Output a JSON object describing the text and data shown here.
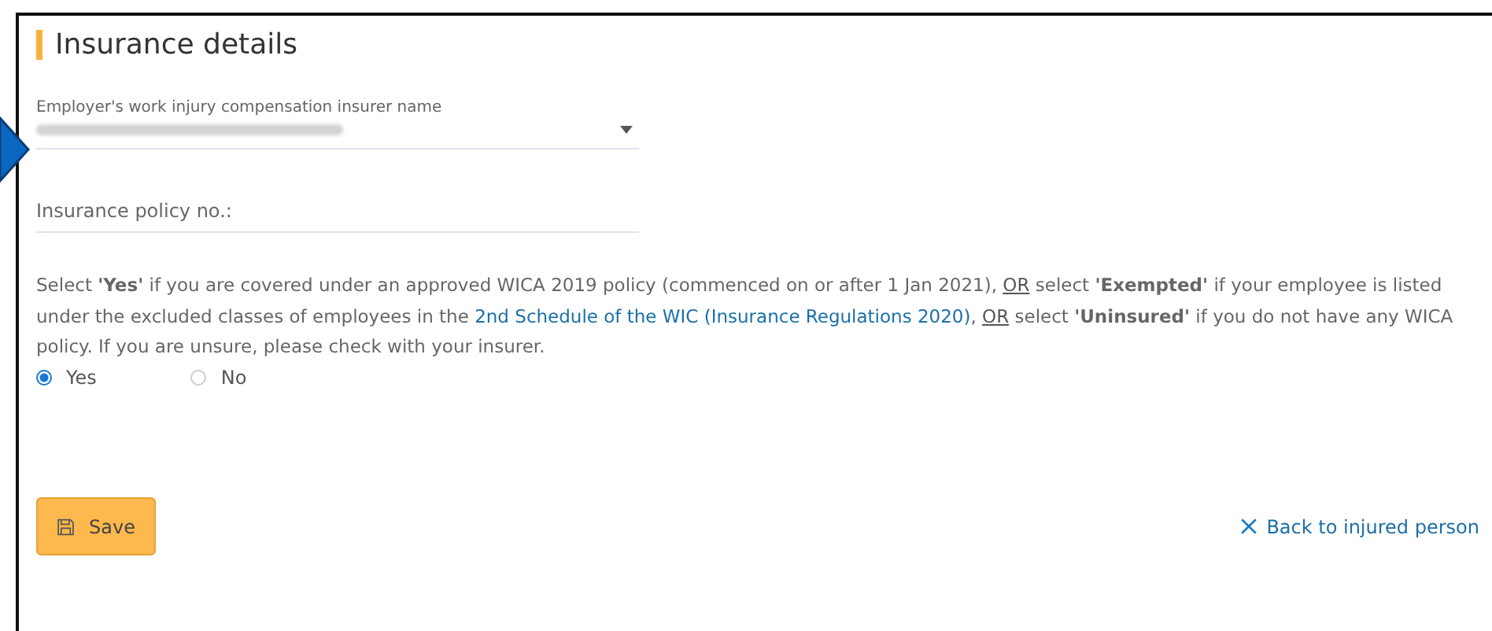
{
  "section": {
    "title": "Insurance details"
  },
  "insurer_field": {
    "label": "Employer's work injury compensation insurer name",
    "redacted": true
  },
  "policy_field": {
    "placeholder": "Insurance policy no.:"
  },
  "note": [
    {
      "kind": "text",
      "text": "Select **'Yes'** if you are covered under an approved WICA 2019 policy (commenced on or after 1 Jan 2021), "
    },
    {
      "kind": "underline",
      "text": "OR"
    },
    {
      "kind": "text",
      "text": " select **'Exempted'** if your employee is listed under the excluded classes of employees in the "
    },
    {
      "kind": "link",
      "text": "2nd Schedule of the WIC (Insurance Regulations 2020)"
    },
    {
      "kind": "text",
      "text": ", "
    },
    {
      "kind": "underline",
      "text": "OR"
    },
    {
      "kind": "text",
      "text": " select **'Uninsured'** if you do not have any WICA policy. If you are unsure, please check with your insurer."
    }
  ],
  "options": [
    {
      "label": "Yes",
      "selected": true
    },
    {
      "label": "No",
      "selected": false
    }
  ],
  "save_button": {
    "label": "Save"
  },
  "back_link": {
    "label": "Back to injured person"
  }
}
